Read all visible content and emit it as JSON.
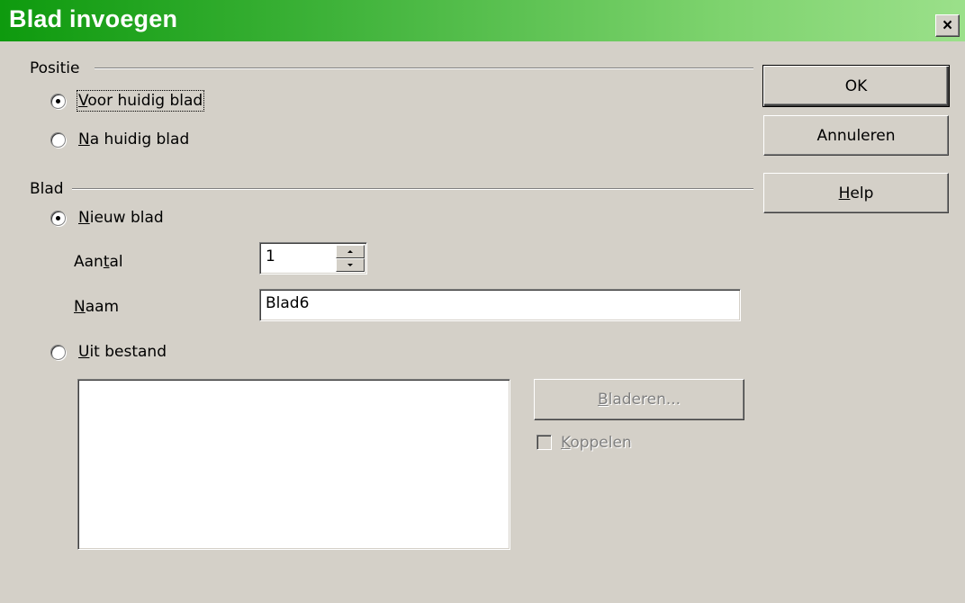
{
  "window": {
    "title": "Blad invoegen",
    "close_label": "×"
  },
  "positie": {
    "title": "Positie",
    "before": {
      "prefix": "",
      "mnemonic": "V",
      "rest": "oor huidig blad",
      "selected": true
    },
    "after": {
      "prefix": "",
      "mnemonic": "N",
      "rest": "a huidig blad",
      "selected": false
    }
  },
  "blad": {
    "title": "Blad",
    "new_sheet": {
      "mnemonic": "N",
      "rest": "ieuw blad",
      "selected": true
    },
    "count": {
      "label_prefix": "Aan",
      "mnemonic": "t",
      "label_rest": "al",
      "value": "1"
    },
    "name": {
      "mnemonic": "N",
      "label_rest": "aam",
      "value": "Blad6"
    },
    "from_file": {
      "mnemonic": "U",
      "rest": "it bestand",
      "selected": false
    },
    "browse": {
      "mnemonic": "B",
      "rest": "laderen..."
    },
    "link": {
      "mnemonic": "K",
      "rest": "oppelen",
      "checked": false
    }
  },
  "buttons": {
    "ok": "OK",
    "cancel": "Annuleren",
    "help": {
      "mnemonic": "H",
      "rest": "elp"
    }
  },
  "icons": [
    "close-icon",
    "spin-up-icon",
    "spin-down-icon"
  ]
}
